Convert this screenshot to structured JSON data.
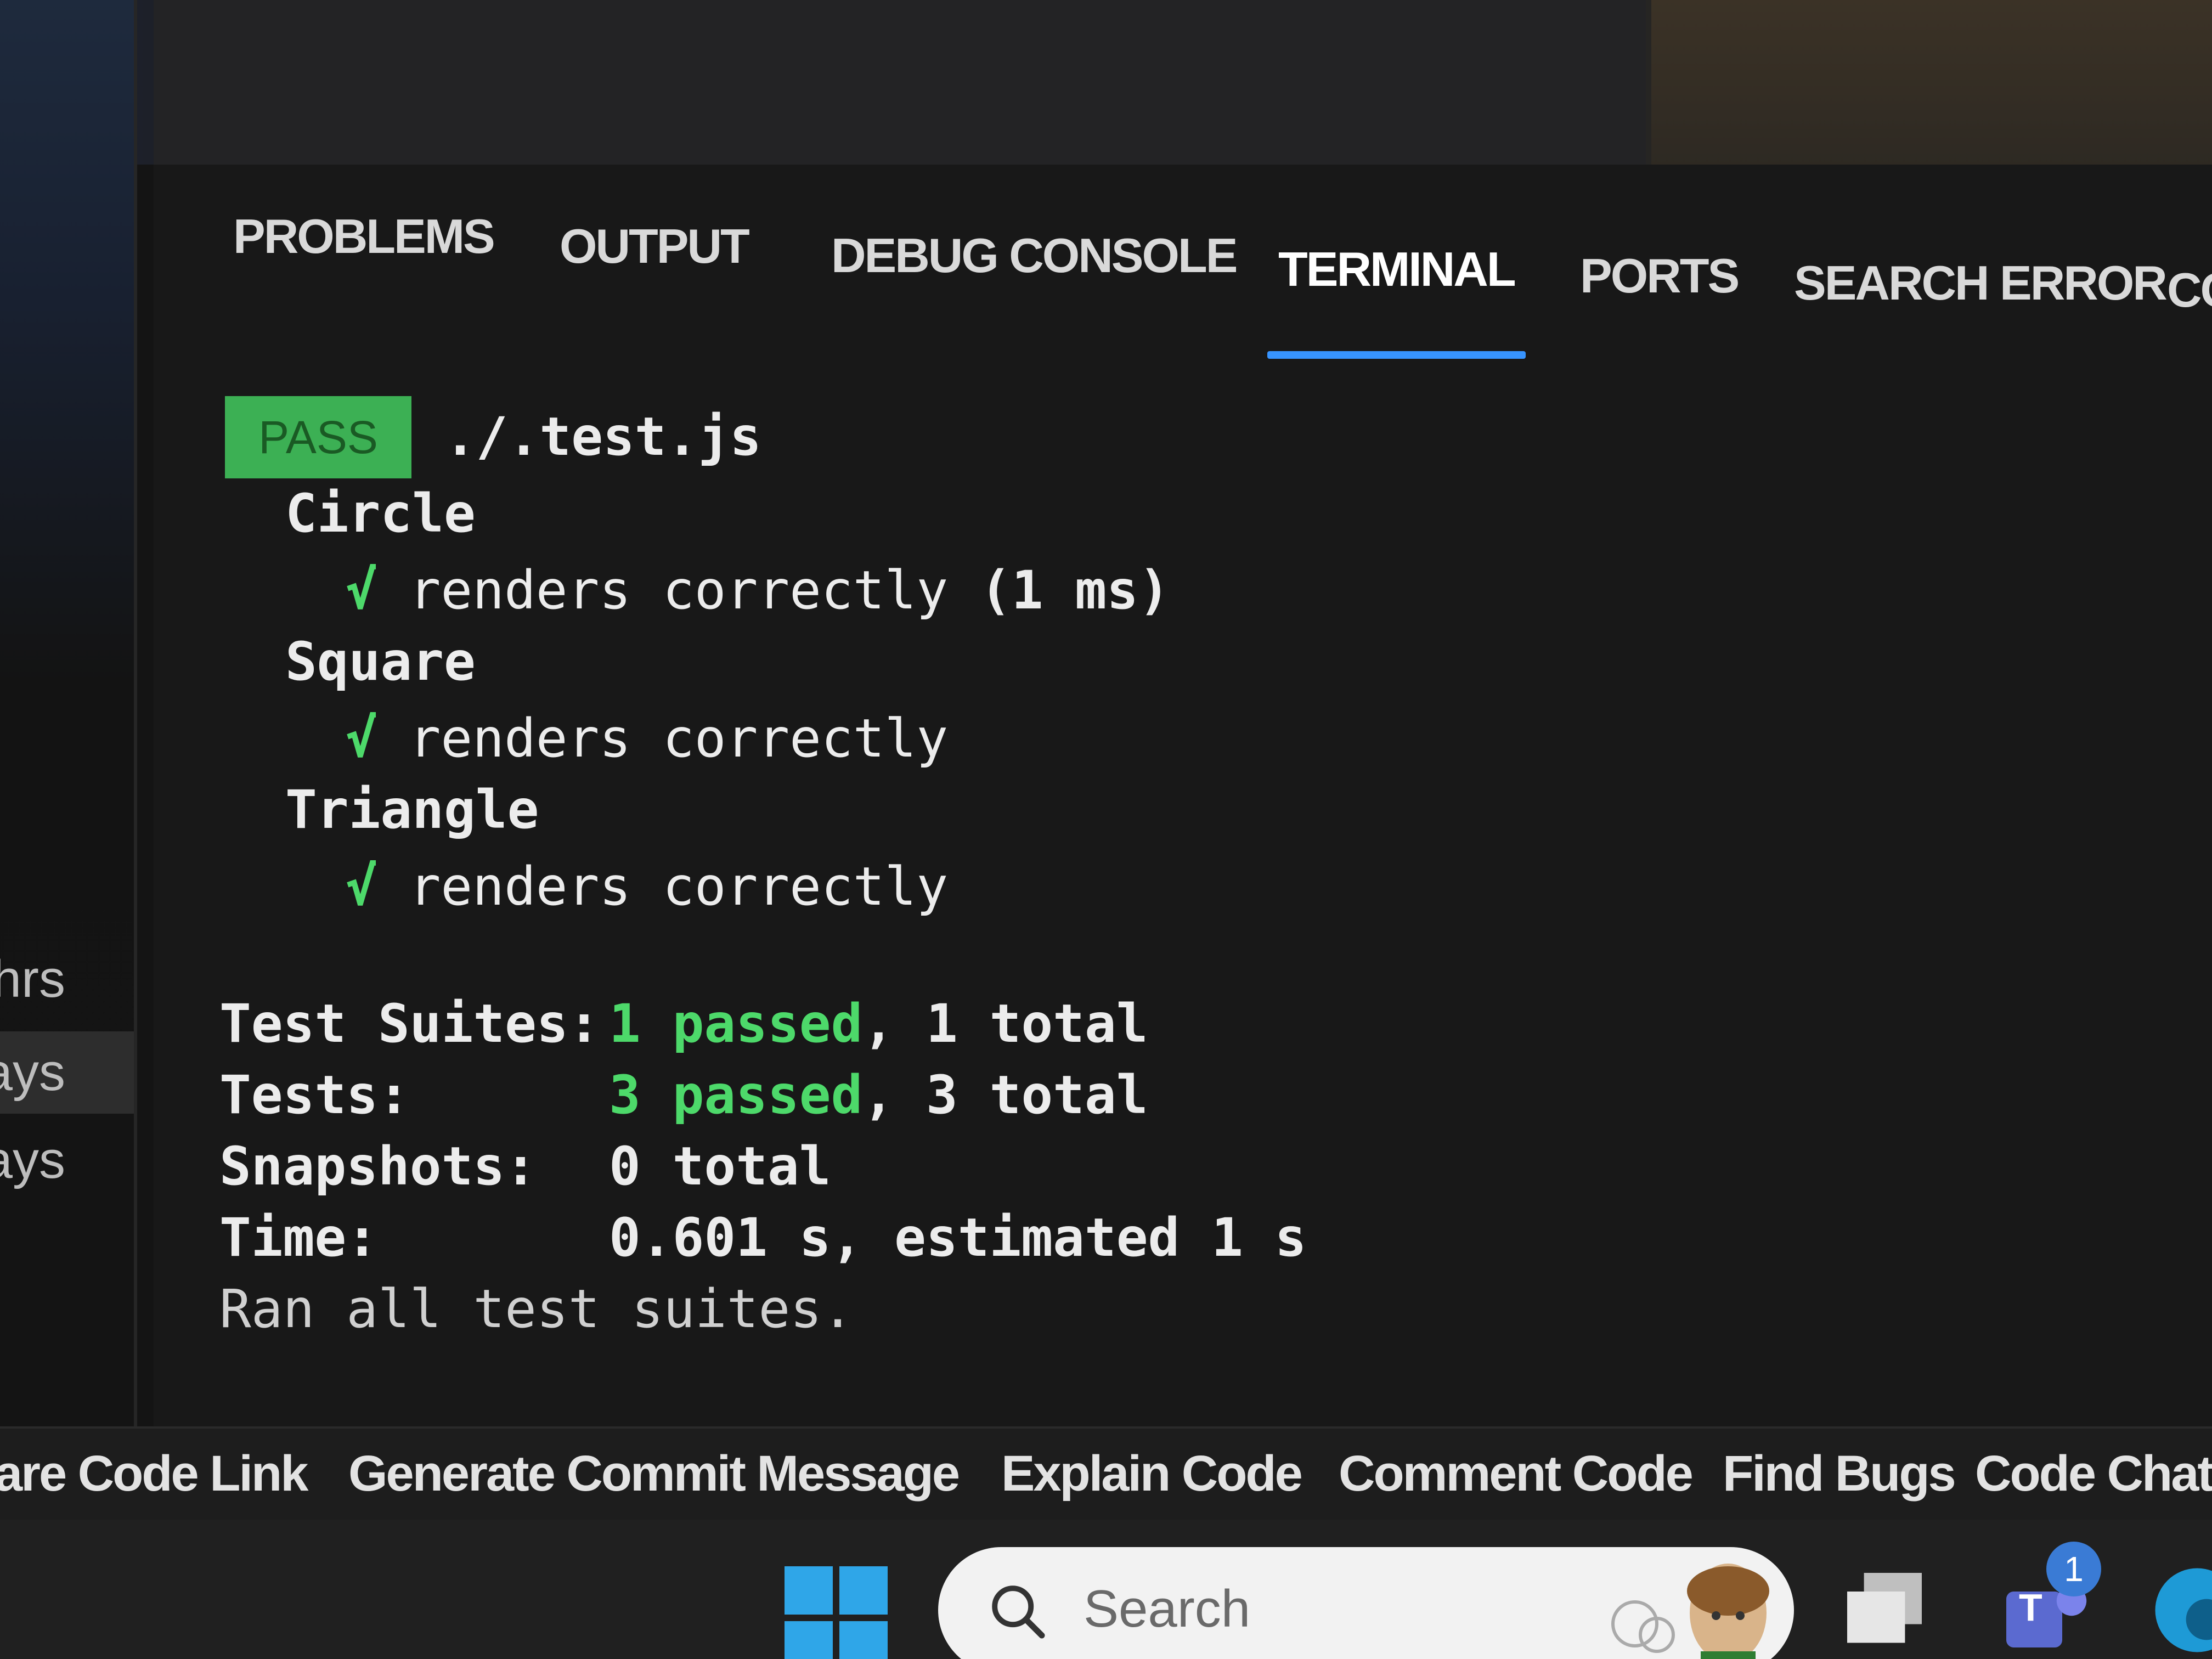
{
  "sidebar": {
    "items": [
      {
        "label": "hrs",
        "active": false
      },
      {
        "label": "ays",
        "active": true
      },
      {
        "label": "ays",
        "active": false
      }
    ]
  },
  "panel": {
    "tabs": [
      {
        "label": "PROBLEMS",
        "active": false
      },
      {
        "label": "OUTPUT",
        "active": false
      },
      {
        "label": "DEBUG CONSOLE",
        "active": false
      },
      {
        "label": "TERMINAL",
        "active": true
      },
      {
        "label": "PORTS",
        "active": false
      },
      {
        "label": "SEARCH ERROR",
        "active": false
      },
      {
        "label": "CC",
        "active": false
      }
    ]
  },
  "terminal": {
    "pass_badge": "PASS",
    "file": "./.test.js",
    "suites": [
      {
        "name": "Circle",
        "check": "√",
        "test": "renders correctly",
        "duration": "(1 ms)"
      },
      {
        "name": "Square",
        "check": "√",
        "test": "renders correctly",
        "duration": ""
      },
      {
        "name": "Triangle",
        "check": "√",
        "test": "renders correctly",
        "duration": ""
      }
    ],
    "summary": {
      "suites_label": "Test Suites:",
      "suites_passed": "1 passed",
      "suites_total": ", 1 total",
      "tests_label": "Tests:",
      "tests_passed": "3 passed",
      "tests_total": ", 3 total",
      "snapshots_label": "Snapshots:",
      "snapshots_value": "0 total",
      "time_label": "Time:",
      "time_value": "0.601 s, estimated 1 s",
      "ran_all": "Ran all test suites."
    }
  },
  "commands": [
    "are Code Link",
    "Generate Commit Message",
    "Explain Code",
    "Comment Code",
    "Find Bugs",
    "Code Chat"
  ],
  "taskbar": {
    "search_placeholder": "Search",
    "teams_badge_count": "1",
    "teams_letter": "T"
  },
  "colors": {
    "pass_green": "#3cb054",
    "check_green": "#4dd96a",
    "tab_underline": "#3794ff",
    "windows_blue": "#2fa6e8"
  },
  "icons": [
    "windows-start-icon",
    "search-icon",
    "task-view-icon",
    "teams-icon",
    "edge-icon"
  ]
}
